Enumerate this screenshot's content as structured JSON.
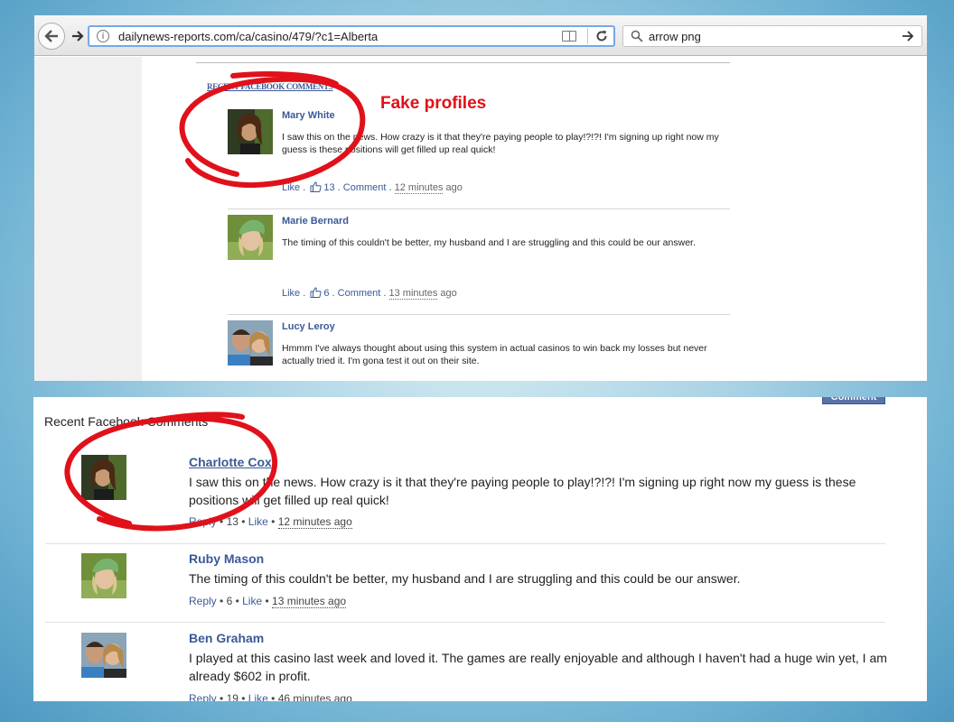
{
  "browser": {
    "url": "dailynews-reports.com/ca/casino/479/?c1=Alberta",
    "search_text": "arrow png"
  },
  "annotation": {
    "label": "Fake profiles",
    "color": "#e0111a"
  },
  "top_comments": {
    "heading": "RECENT FACEBOOK COMMENTS",
    "like_label": "Like",
    "comment_label": "Comment",
    "items": [
      {
        "name": "Mary White",
        "text": "I saw this on the news. How crazy is it that they're paying people to play!?!?! I'm signing up right now my guess is these positions will get filled up real quick!",
        "likes": "13",
        "time": "12 minutes",
        "ago": "ago"
      },
      {
        "name": "Marie Bernard",
        "text": "The timing of this couldn't be better, my husband and I are struggling and this could be our answer.",
        "likes": "6",
        "time": "13 minutes",
        "ago": "ago"
      },
      {
        "name": "Lucy Leroy",
        "text": "Hmmm I've always thought about using this system in actual casinos to win back my losses but never actually tried it. I'm gona test it out on their site."
      }
    ]
  },
  "bottom_comments": {
    "heading": "Recent Facebook Comments",
    "comment_button": "Comment",
    "reply_label": "Reply",
    "like_label": "Like",
    "items": [
      {
        "name": "Charlotte Cox",
        "text": "I saw this on the news. How crazy is it that they're paying people to play!?!?! I'm signing up right now my guess is these positions will get filled up real quick!",
        "likes": "13",
        "time": "12 minutes ago"
      },
      {
        "name": "Ruby Mason",
        "text": "The timing of this couldn't be better, my husband and I are struggling and this could be our answer.",
        "likes": "6",
        "time": "13 minutes ago"
      },
      {
        "name": "Ben Graham",
        "text": "I played at this casino last week and loved it. The games are really enjoyable and although I haven't had a huge win yet, I am already $602 in profit.",
        "likes": "19",
        "time": "46 minutes ago"
      }
    ]
  }
}
